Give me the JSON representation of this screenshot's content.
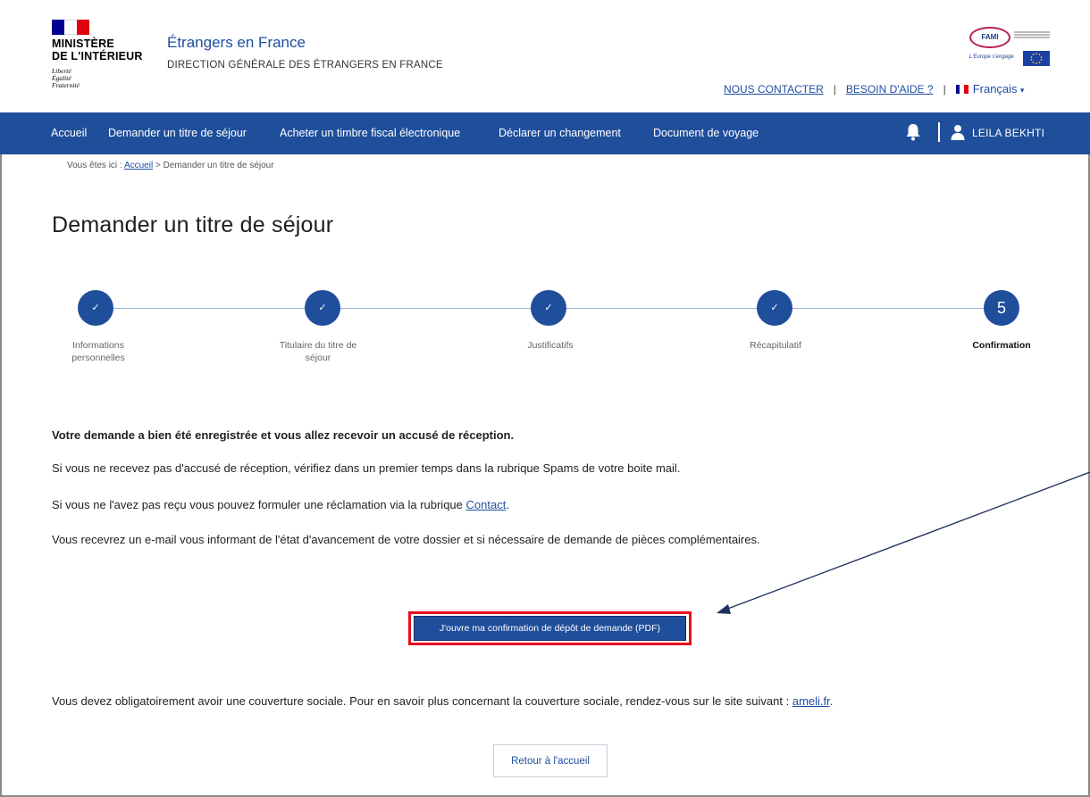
{
  "header": {
    "ministere_line1": "MINISTÈRE",
    "ministere_line2": "DE L'INTÉRIEUR",
    "devise": [
      "Liberté",
      "Égalité",
      "Fraternité"
    ],
    "site_title": "Étrangers en France",
    "site_subtitle": "DIRECTION GÉNÉRALE DES ÉTRANGERS EN FRANCE",
    "faml_logo": "FAMI",
    "faml_caption": "L'Europe s'engage",
    "links": {
      "contact": "NOUS CONTACTER",
      "help": "BESOIN D'AIDE ?",
      "lang": "Français",
      "lang_caret": "▾"
    }
  },
  "nav": {
    "items": [
      "Accueil",
      "Demander un titre de séjour",
      "Acheter un timbre fiscal électronique",
      "Déclarer un changement",
      "Document de voyage"
    ],
    "user_name": "LEILA BEKHTI"
  },
  "breadcrumb": {
    "prefix": "Vous êtes ici : ",
    "home": "Accueil",
    "separator": " > ",
    "current": "Demander un titre de séjour"
  },
  "page_title": "Demander un titre de séjour",
  "steps": [
    {
      "mark": "✓",
      "label_line1": "Informations",
      "label_line2": "personnelles",
      "state": "done"
    },
    {
      "mark": "✓",
      "label_line1": "Titulaire du titre de",
      "label_line2": "séjour",
      "state": "done"
    },
    {
      "mark": "✓",
      "label_line1": "Justificatifs",
      "label_line2": "",
      "state": "done"
    },
    {
      "mark": "✓",
      "label_line1": "Récapitulatif",
      "label_line2": "",
      "state": "done"
    },
    {
      "mark": "5",
      "label_line1": "Confirmation",
      "label_line2": "",
      "state": "active"
    }
  ],
  "messages": {
    "registered": "Votre demande a bien été enregistrée et vous allez recevoir un accusé de réception.",
    "spam": "Si vous ne recevez pas d'accusé de réception, vérifiez dans un premier temps dans la rubrique Spams de votre boite mail.",
    "claim_before": "Si vous ne l'avez pas reçu vous pouvez formuler une réclamation via la rubrique ",
    "claim_link": "Contact",
    "claim_after": ".",
    "email": "Vous recevrez un e-mail vous informant de l'état d'avancement de votre dossier et si nécessaire de demande de pièces complémentaires.",
    "coverage_before": "Vous devez obligatoirement avoir une couverture sociale. Pour en savoir plus concernant la couverture sociale, rendez-vous sur le site suivant : ",
    "coverage_link": "ameli.fr",
    "coverage_after": "."
  },
  "buttons": {
    "pdf": "J'ouvre ma confirmation de dépôt de demande (PDF)",
    "return": "Retour à l'accueil"
  },
  "colors": {
    "primary": "#1f4e9b",
    "highlight": "#e5101e",
    "link": "#1f4ea1"
  }
}
